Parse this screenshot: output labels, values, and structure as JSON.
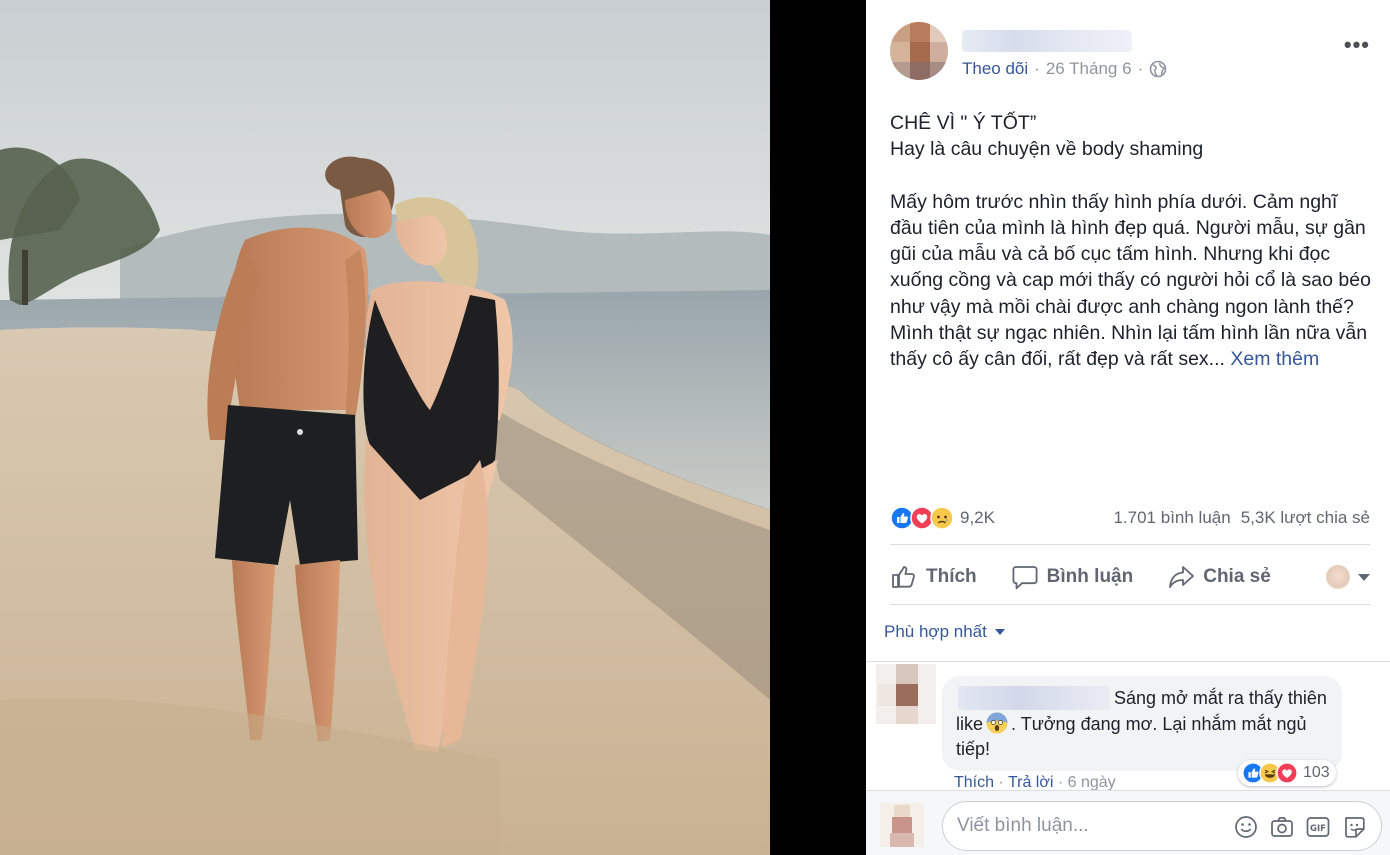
{
  "post": {
    "follow_label": "Theo dõi",
    "date": "26 Tháng 6",
    "separator": "·",
    "more_label": "•••",
    "title_line": "CHÊ VÌ \" Ý TỐT”",
    "subtitle_line": "Hay là câu chuyện về body shaming",
    "body": "Mấy hôm trước nhìn thấy hình phía dưới. Cảm nghĩ đầu tiên của mình là hình đẹp quá. Người mẫu, sự gần gũi của mẫu và cả bố cục tấm hình. Nhưng khi đọc xuống cồng và cap mới thấy có người hỏi cổ là sao béo như vậy mà mồi chài được anh chàng ngon lành thế? Mình thật sự ngạc nhiên. Nhìn lại tấm hình lần nữa vẫn thấy cô ấy cân đối, rất đẹp và rất sex...",
    "see_more": "Xem thêm"
  },
  "stats": {
    "reactions_count": "9,2K",
    "comments": "1.701 bình luận",
    "shares": "5,3K lượt chia sẻ",
    "reaction_icons": [
      "like-icon",
      "love-icon",
      "sad-icon"
    ]
  },
  "actions": {
    "like": "Thích",
    "comment": "Bình luận",
    "share": "Chia sẻ"
  },
  "comments": {
    "sort_label": "Phù hợp nhất",
    "items": [
      {
        "text_before": "Sáng mở mắt ra thấy thiên like",
        "text_after": ". Tưởng đang mơ. Lại nhắm mắt ngủ tiếp!",
        "emoji": "scream-icon",
        "reaction_count": "103",
        "like_link": "Thích",
        "reply_link": "Trả lời",
        "time": "6 ngày",
        "dot": "·"
      }
    ]
  },
  "composer": {
    "placeholder": "Viết bình luận..."
  },
  "colors": {
    "link": "#365899",
    "meta": "#90949c",
    "text": "#1d2129",
    "like_blue": "#1877f2",
    "love_red": "#f33e58"
  }
}
